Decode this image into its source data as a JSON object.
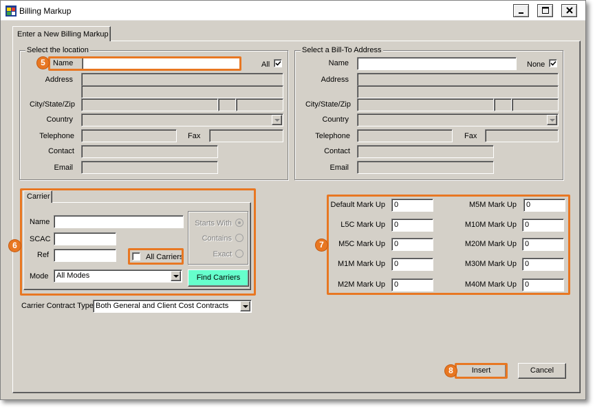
{
  "window": {
    "title": "Billing Markup"
  },
  "tab": {
    "label": "Enter a New Billing Markup"
  },
  "location": {
    "legend": "Select the location",
    "name_label": "Name",
    "name_value": "",
    "all_label": "All",
    "all_checked": true,
    "address_label": "Address",
    "city_label": "City/State/Zip",
    "country_label": "Country",
    "telephone_label": "Telephone",
    "fax_label": "Fax",
    "contact_label": "Contact",
    "email_label": "Email"
  },
  "billto": {
    "legend": "Select a Bill-To Address",
    "name_label": "Name",
    "name_value": "",
    "none_label": "None",
    "none_checked": true,
    "address_label": "Address",
    "city_label": "City/State/Zip",
    "country_label": "Country",
    "telephone_label": "Telephone",
    "fax_label": "Fax",
    "contact_label": "Contact",
    "email_label": "Email"
  },
  "carrier": {
    "tab_label": "Carrier",
    "name_label": "Name",
    "scac_label": "SCAC",
    "ref_label": "Ref",
    "all_carriers_label": "All Carriers",
    "all_carriers_checked": false,
    "mode_label": "Mode",
    "mode_value": "All Modes",
    "match_options": [
      "Starts With",
      "Contains",
      "Exact"
    ],
    "match_selected": "Starts With",
    "find_button": "Find Carriers"
  },
  "contract": {
    "label": "Carrier Contract Type",
    "value": "Both General and Client Cost Contracts"
  },
  "markups": {
    "left": [
      {
        "label": "Default Mark Up",
        "value": "0"
      },
      {
        "label": "L5C Mark Up",
        "value": "0"
      },
      {
        "label": "M5C Mark Up",
        "value": "0"
      },
      {
        "label": "M1M Mark Up",
        "value": "0"
      },
      {
        "label": "M2M Mark Up",
        "value": "0"
      }
    ],
    "right": [
      {
        "label": "M5M Mark Up",
        "value": "0"
      },
      {
        "label": "M10M Mark Up",
        "value": "0"
      },
      {
        "label": "M20M Mark Up",
        "value": "0"
      },
      {
        "label": "M30M Mark Up",
        "value": "0"
      },
      {
        "label": "M40M Mark Up",
        "value": "0"
      }
    ]
  },
  "buttons": {
    "insert": "Insert",
    "cancel": "Cancel"
  },
  "callouts": {
    "location_name": "5",
    "carrier": "6",
    "markups": "7",
    "insert": "8"
  },
  "colors": {
    "highlight": "#e87722",
    "find_button": "#66ffcc",
    "window_bg": "#d4d0c8"
  }
}
